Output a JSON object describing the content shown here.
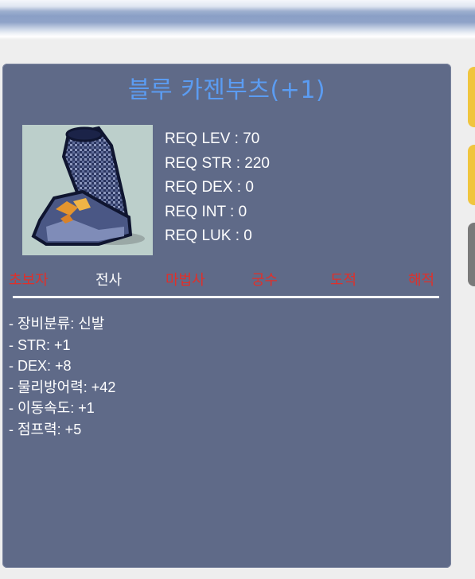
{
  "item": {
    "name": "블루 카젠부츠(+1)",
    "icon": "blue-boots-icon"
  },
  "requirements": [
    {
      "label": "REQ LEV",
      "value": "70"
    },
    {
      "label": "REQ STR",
      "value": "220"
    },
    {
      "label": "REQ DEX",
      "value": "0"
    },
    {
      "label": "REQ INT",
      "value": "0"
    },
    {
      "label": "REQ LUK",
      "value": "0"
    }
  ],
  "jobs": [
    {
      "name": "초보자",
      "color": "#e0302a"
    },
    {
      "name": "전사",
      "color": "#ffffff"
    },
    {
      "name": "마법사",
      "color": "#e0302a"
    },
    {
      "name": "궁수",
      "color": "#e0302a"
    },
    {
      "name": "도적",
      "color": "#e0302a"
    },
    {
      "name": "해적",
      "color": "#e0302a"
    }
  ],
  "stats": [
    "- 장비분류: 신발",
    "- STR: +1",
    "- DEX: +8",
    "- 물리방어력: +42",
    "- 이동속도: +1",
    "- 점프력: +5"
  ],
  "colors": {
    "panel": "#5f6a88",
    "title": "#5b9cf2",
    "job_available": "#ffffff",
    "job_unavailable": "#e0302a"
  }
}
